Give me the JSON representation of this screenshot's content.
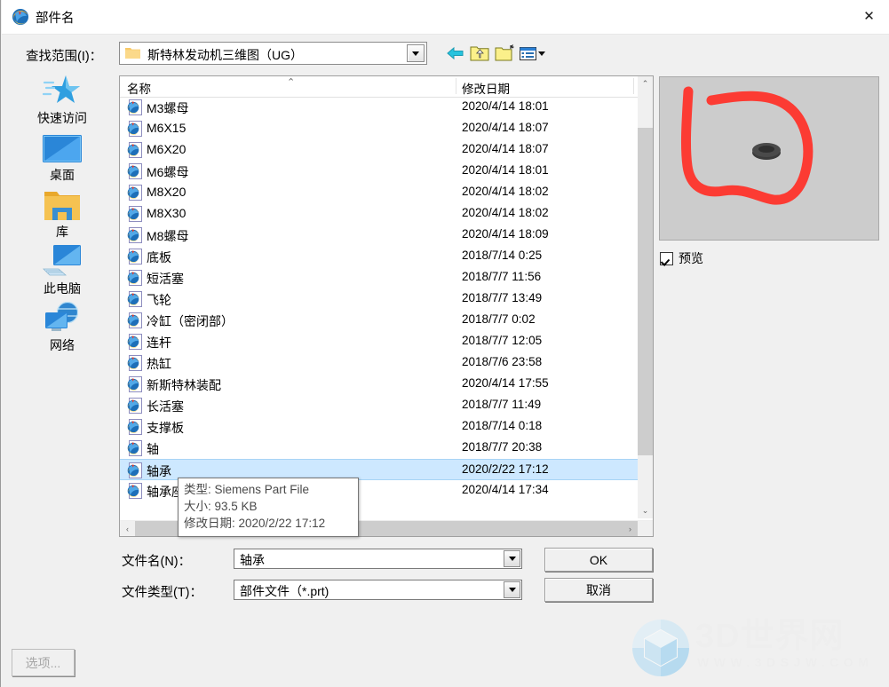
{
  "window": {
    "title": "部件名",
    "title_icon": "nx-part-icon",
    "close_label": "✕"
  },
  "lookin": {
    "label": "查找范围(I)：",
    "value": "斯特林发动机三维图（UG）",
    "folder_icon": "folder-icon",
    "dropdown_icon": "chevron-down-icon"
  },
  "toolbar": [
    {
      "name": "back-button",
      "icon": "back-arrow-icon"
    },
    {
      "name": "up-folder-button",
      "icon": "up-folder-icon"
    },
    {
      "name": "new-folder-button",
      "icon": "new-folder-icon"
    },
    {
      "name": "views-button",
      "icon": "views-list-icon"
    }
  ],
  "places": [
    {
      "label": "快速访问",
      "icon": "star-icon"
    },
    {
      "label": "桌面",
      "icon": "desktop-icon"
    },
    {
      "label": "库",
      "icon": "library-folder-icon"
    },
    {
      "label": "此电脑",
      "icon": "this-pc-icon"
    },
    {
      "label": "网络",
      "icon": "network-icon"
    }
  ],
  "filelist": {
    "columns": [
      "名称",
      "修改日期"
    ],
    "sort_indicator": "⌃",
    "rows": [
      {
        "name": "M3螺母",
        "date": "2020/4/14 18:01",
        "selected": false
      },
      {
        "name": "M6X15",
        "date": "2020/4/14 18:07",
        "selected": false
      },
      {
        "name": "M6X20",
        "date": "2020/4/14 18:07",
        "selected": false
      },
      {
        "name": "M6螺母",
        "date": "2020/4/14 18:01",
        "selected": false
      },
      {
        "name": "M8X20",
        "date": "2020/4/14 18:02",
        "selected": false
      },
      {
        "name": "M8X30",
        "date": "2020/4/14 18:02",
        "selected": false
      },
      {
        "name": "M8螺母",
        "date": "2020/4/14 18:09",
        "selected": false
      },
      {
        "name": "底板",
        "date": "2018/7/14 0:25",
        "selected": false
      },
      {
        "name": "短活塞",
        "date": "2018/7/7 11:56",
        "selected": false
      },
      {
        "name": "飞轮",
        "date": "2018/7/7 13:49",
        "selected": false
      },
      {
        "name": "冷缸（密闭部）",
        "date": "2018/7/7 0:02",
        "selected": false
      },
      {
        "name": "连杆",
        "date": "2018/7/7 12:05",
        "selected": false
      },
      {
        "name": "热缸",
        "date": "2018/7/6 23:58",
        "selected": false
      },
      {
        "name": "新斯特林装配",
        "date": "2020/4/14 17:55",
        "selected": false
      },
      {
        "name": "长活塞",
        "date": "2018/7/7 11:49",
        "selected": false
      },
      {
        "name": "支撑板",
        "date": "2018/7/14 0:18",
        "selected": false
      },
      {
        "name": "轴",
        "date": "2018/7/7 20:38",
        "selected": false
      },
      {
        "name": "轴承",
        "date": "2020/2/22 17:12",
        "selected": true
      },
      {
        "name": "轴承座",
        "date": "2020/4/14 17:34",
        "selected": false
      }
    ]
  },
  "tooltip": {
    "type_line": "类型: Siemens Part File",
    "size_line": "大小: 93.5 KB",
    "date_line": "修改日期: 2020/2/22 17:12"
  },
  "preview": {
    "checkbox_label": "预览",
    "checked": true,
    "annotation_color": "#fc3b33",
    "background_color": "#cccccc"
  },
  "form": {
    "filename_label": "文件名(N)：",
    "filename_value": "轴承",
    "filetype_label": "文件类型(T)：",
    "filetype_value": "部件文件（*.prt)"
  },
  "buttons": {
    "ok": "OK",
    "cancel": "取消",
    "options": "选项..."
  },
  "watermark": {
    "text": "3D世界网",
    "sub": "WWW.3DSJW.COM"
  },
  "scroll": {
    "up": "⌃",
    "down": "⌄",
    "left": "‹",
    "right": "›"
  }
}
